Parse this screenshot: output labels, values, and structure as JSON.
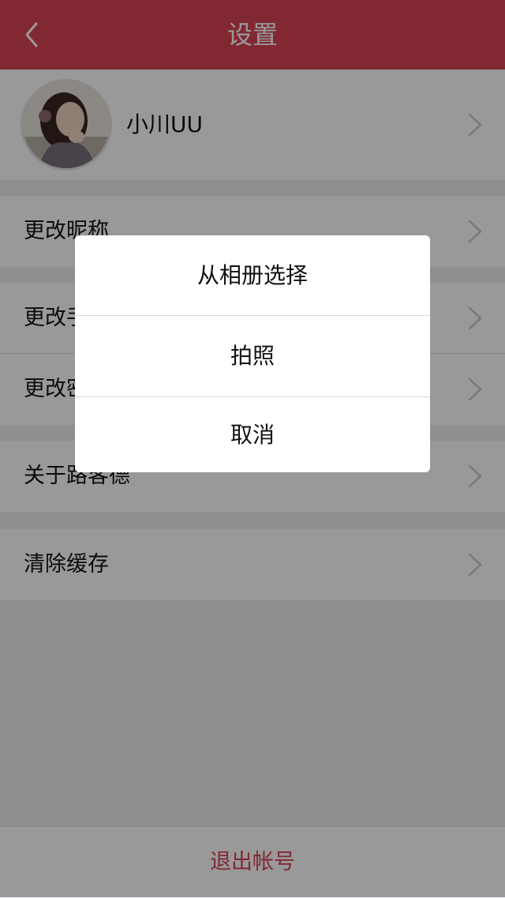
{
  "nav": {
    "title": "设置",
    "back_icon": "chevron-left-icon"
  },
  "profile": {
    "name": "小川UU",
    "avatar": "user-avatar-photo"
  },
  "settings": {
    "items": [
      {
        "label": "更改昵称"
      },
      {
        "label": "更改手机号"
      },
      {
        "label": "更改密码"
      },
      {
        "label": "关于路客德"
      },
      {
        "label": "清除缓存"
      }
    ]
  },
  "footer": {
    "logout_label": "退出帐号"
  },
  "action_sheet": {
    "options": [
      {
        "label": "从相册选择"
      },
      {
        "label": "拍照"
      },
      {
        "label": "取消"
      }
    ]
  },
  "colors": {
    "accent": "#d84355",
    "background": "#efeff4",
    "overlay": "rgba(0,0,0,0.4)"
  }
}
